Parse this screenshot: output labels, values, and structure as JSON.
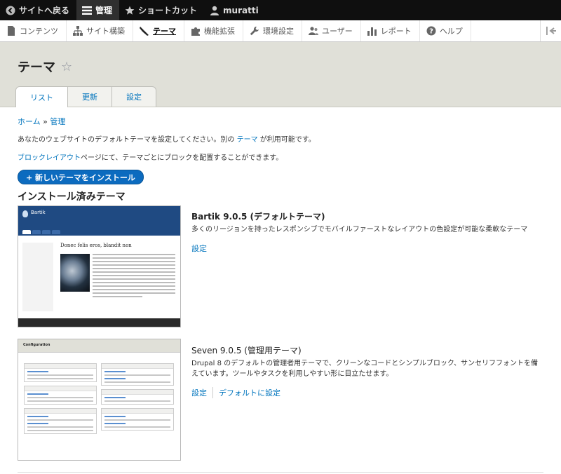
{
  "toolbar": {
    "back": "サイトへ戻る",
    "manage": "管理",
    "shortcuts": "ショートカット",
    "user": "muratti"
  },
  "tray": {
    "items": [
      {
        "label": "コンテンツ",
        "icon": "file-icon"
      },
      {
        "label": "サイト構築",
        "icon": "sitemap-icon"
      },
      {
        "label": "テーマ",
        "icon": "paintbrush-icon"
      },
      {
        "label": "機能拡張",
        "icon": "puzzle-icon"
      },
      {
        "label": "環境設定",
        "icon": "wrench-icon"
      },
      {
        "label": "ユーザー",
        "icon": "people-icon"
      },
      {
        "label": "レポート",
        "icon": "bar-chart-icon"
      },
      {
        "label": "ヘルプ",
        "icon": "question-icon"
      }
    ]
  },
  "page": {
    "title": "テーマ",
    "tabs": [
      "リスト",
      "更新",
      "設定"
    ]
  },
  "breadcrumb": {
    "home": "ホーム",
    "sep": "»",
    "admin": "管理"
  },
  "help": {
    "line1_pre": "あなたのウェブサイトのデフォルトテーマを設定してください。別の",
    "line1_link": "テーマ",
    "line1_post": "が利用可能です。",
    "line2_link": "ブロックレイアウト",
    "line2_post": "ページにて、テーマごとにブロックを配置することができます。"
  },
  "install_button": "+ 新しいテーマをインストール",
  "installed_title": "インストール済みテーマ",
  "themes": [
    {
      "name": "Bartik",
      "version": "9.0.5 (デフォルトテーマ)",
      "description": "多くのリージョンを持ったレスポンシブでモバイルファーストなレイアウトの色設定が可能な柔軟なテーマ",
      "links": [
        "設定"
      ],
      "screenshot": {
        "site_name": "Bartik",
        "article_title": "Donec felis eros, blandit non"
      }
    },
    {
      "name": "Seven",
      "version": "9.0.5 (管理用テーマ)",
      "description": "Drupal 8 のデフォルトの管理者用テーマで、クリーンなコードとシンプルブロック、サンセリフフォントを備えています。ツールやタスクを利用しやすい形に目立たせます。",
      "links": [
        "設定",
        "デフォルトに設定"
      ],
      "screenshot": {
        "page_title": "Configuration"
      }
    }
  ]
}
